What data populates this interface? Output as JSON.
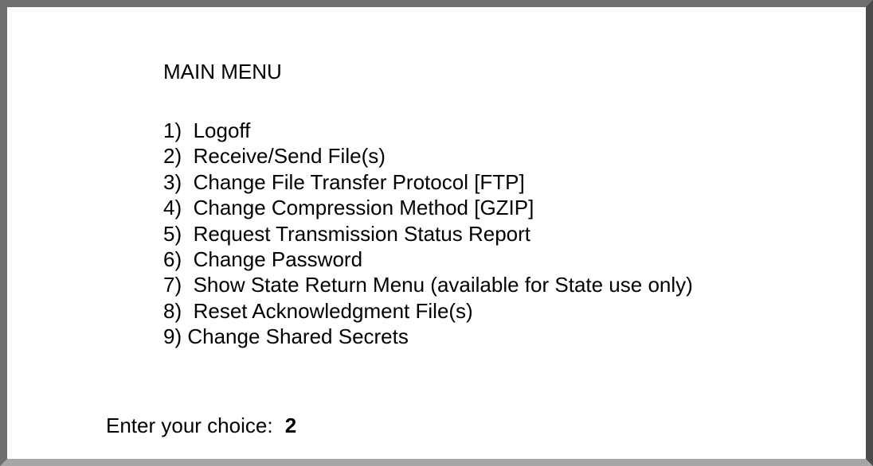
{
  "menu": {
    "title": "MAIN MENU",
    "items": [
      {
        "num": "1)",
        "gap": "  ",
        "label": "Logoff"
      },
      {
        "num": "2)",
        "gap": "  ",
        "label": "Receive/Send File(s)"
      },
      {
        "num": "3)",
        "gap": "  ",
        "label": "Change File Transfer Protocol [FTP]"
      },
      {
        "num": "4)",
        "gap": "  ",
        "label": "Change Compression Method [GZIP]"
      },
      {
        "num": "5)",
        "gap": "  ",
        "label": "Request Transmission Status Report"
      },
      {
        "num": "6)",
        "gap": "  ",
        "label": "Change Password"
      },
      {
        "num": "7)",
        "gap": "  ",
        "label": "Show State Return Menu (available for State use only)"
      },
      {
        "num": "8)",
        "gap": "  ",
        "label": "Reset Acknowledgment File(s)"
      },
      {
        "num": "9)",
        "gap": " ",
        "label": "Change Shared Secrets"
      }
    ]
  },
  "prompt": {
    "label": "Enter your choice:",
    "value": "2"
  }
}
